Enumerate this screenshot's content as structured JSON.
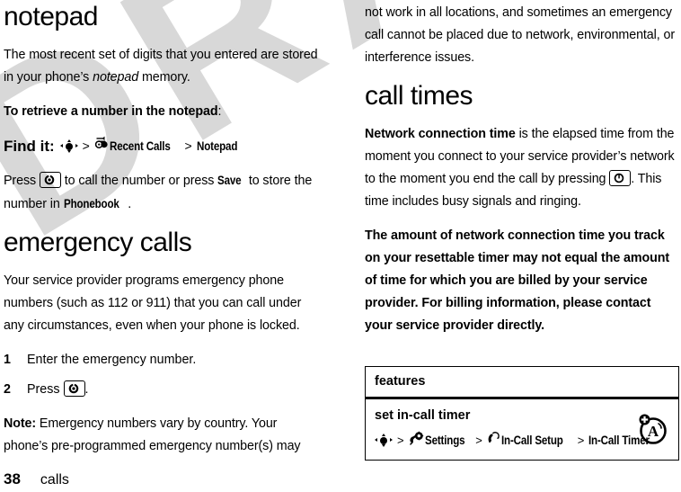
{
  "watermark": {
    "text": "DRAFT"
  },
  "footer": {
    "page_number": "38",
    "chapter": "calls"
  },
  "left_column": {
    "notepad": {
      "title": "notepad",
      "intro_part1": "The most recent set of digits that you entered are stored in your phone’s ",
      "intro_italic": "notepad",
      "intro_part2": " memory.",
      "lead_bold": "To retrieve a number in the notepad",
      "lead_colon": ":",
      "find_it_label": "Find it:",
      "find_it_sep": ">",
      "find_it_item1": "Recent Calls",
      "find_it_item2": "Notepad",
      "press_part1": "Press ",
      "press_part2": " to call the number or press ",
      "press_save": "Save",
      "press_part3": " to store the number in ",
      "press_phonebook": "Phonebook",
      "press_part4": "."
    },
    "emergency": {
      "title": "emergency calls",
      "intro": "Your service provider programs emergency phone numbers (such as 112 or 911) that you can call under any circumstances, even when your phone is locked.",
      "steps": [
        {
          "num": "1",
          "text": "Enter the emergency number.",
          "has_key": false
        },
        {
          "num": "2",
          "text_before": "Press ",
          "text_after": ".",
          "has_key": true
        }
      ],
      "note_label": "Note:",
      "note_text": " Emergency numbers vary by country. Your phone’s pre-programmed emergency number(s) may"
    }
  },
  "right_column": {
    "continuation": "not work in all locations, and sometimes an emergency call cannot be placed due to network, environmental, or interference issues.",
    "call_times": {
      "title": "call times",
      "para1_bold": "Network connection time",
      "para1_part1": " is the elapsed time from the moment you connect to your service provider’s network to the moment you end the call by pressing ",
      "para1_part2": ". This time includes busy signals and ringing.",
      "para2_bold": "The amount of network connection time you track on your resettable timer may not equal the amount of time for which you are billed by your service provider. For billing information, please contact your service provider directly."
    },
    "features_table": {
      "header": "features",
      "rows": [
        {
          "title": "set in-call timer",
          "path_sep": ">",
          "path_item1": "Settings",
          "path_item2": "In-Call Setup",
          "path_item3": "In-Call Timer"
        }
      ]
    }
  },
  "colors": {
    "watermark": "#d8d8d8",
    "text": "#000000",
    "background": "#ffffff"
  }
}
